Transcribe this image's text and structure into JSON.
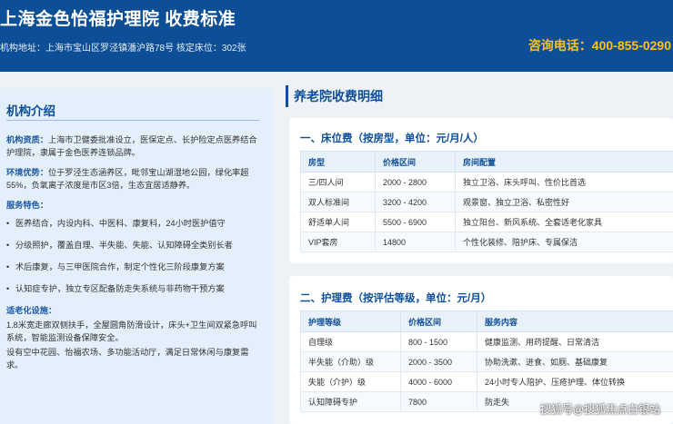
{
  "header": {
    "title": "上海金色怡福护理院 收费标准",
    "address": "机构地址：上海市宝山区罗泾镇潘沪路78号 核定床位：302张",
    "phone": "咨询电话：400-855-0290"
  },
  "intro": {
    "heading": "机构介绍",
    "qual_label": "机构资质：",
    "qual_text": "上海市卫健委批准设立，医保定点、长护险定点医养结合护理院，隶属于金色医养连锁品牌。",
    "env_label": "环境优势：",
    "env_text": "位于罗泾生态涵养区，毗邻宝山湖湿地公园，绿化率超55%，负氧离子浓度是市区3倍，生态宜居适静养。",
    "features_label": "服务特色：",
    "features": [
      "医养结合，内设内科、中医科、康复科，24小时医护值守",
      "分级照护，覆盖自理、半失能、失能、认知障碍全类别长者",
      "术后康复，与三甲医院合作，制定个性化三阶段康复方案",
      "认知症专护，独立专区配备防走失系统与非药物干预方案"
    ],
    "facilities_label": "适老化设施：",
    "facilities_text1": "1.8米宽走廊双侧扶手，全屋圆角防滑设计，床头+卫生间双紧急呼叫系统，智能监测设备保障安全。",
    "facilities_text2": "设有空中花园、怡福农场、多功能活动厅，满足日常休闲与康复需求。"
  },
  "fees": {
    "section_title": "养老院收费明细",
    "bed": {
      "heading": "一、床位费（按房型，单位：元/月/人）",
      "columns": [
        "房型",
        "价格区间",
        "房间配置"
      ],
      "rows": [
        [
          "三/四人间",
          "2000 - 2800",
          "独立卫浴、床头呼叫、性价比首选"
        ],
        [
          "双人标准间",
          "3200 - 4200",
          "观景窗、独立卫浴、私密性好"
        ],
        [
          "舒适单人间",
          "5500 - 6900",
          "独立阳台、新风系统、全套适老化家具"
        ],
        [
          "VIP套房",
          "14800",
          "个性化装修、陪护床、专属保洁"
        ]
      ]
    },
    "care": {
      "heading": "二、护理费（按评估等级，单位：元/月）",
      "columns": [
        "护理等级",
        "价格区间",
        "服务内容"
      ],
      "rows": [
        [
          "自理级",
          "800 - 1500",
          "健康监测、用药提醒、日常清洁"
        ],
        [
          "半失能（介助）级",
          "2000 - 3500",
          "协助洗漱、进食、如厕、基础康复"
        ],
        [
          "失能（介护）级",
          "4000 - 6000",
          "24小时专人陪护、压疮护理、体位转换"
        ],
        [
          "认知障碍专护",
          "7800",
          "防走失"
        ]
      ]
    }
  },
  "watermark": "搜狐号@搜狐焦点白银站"
}
